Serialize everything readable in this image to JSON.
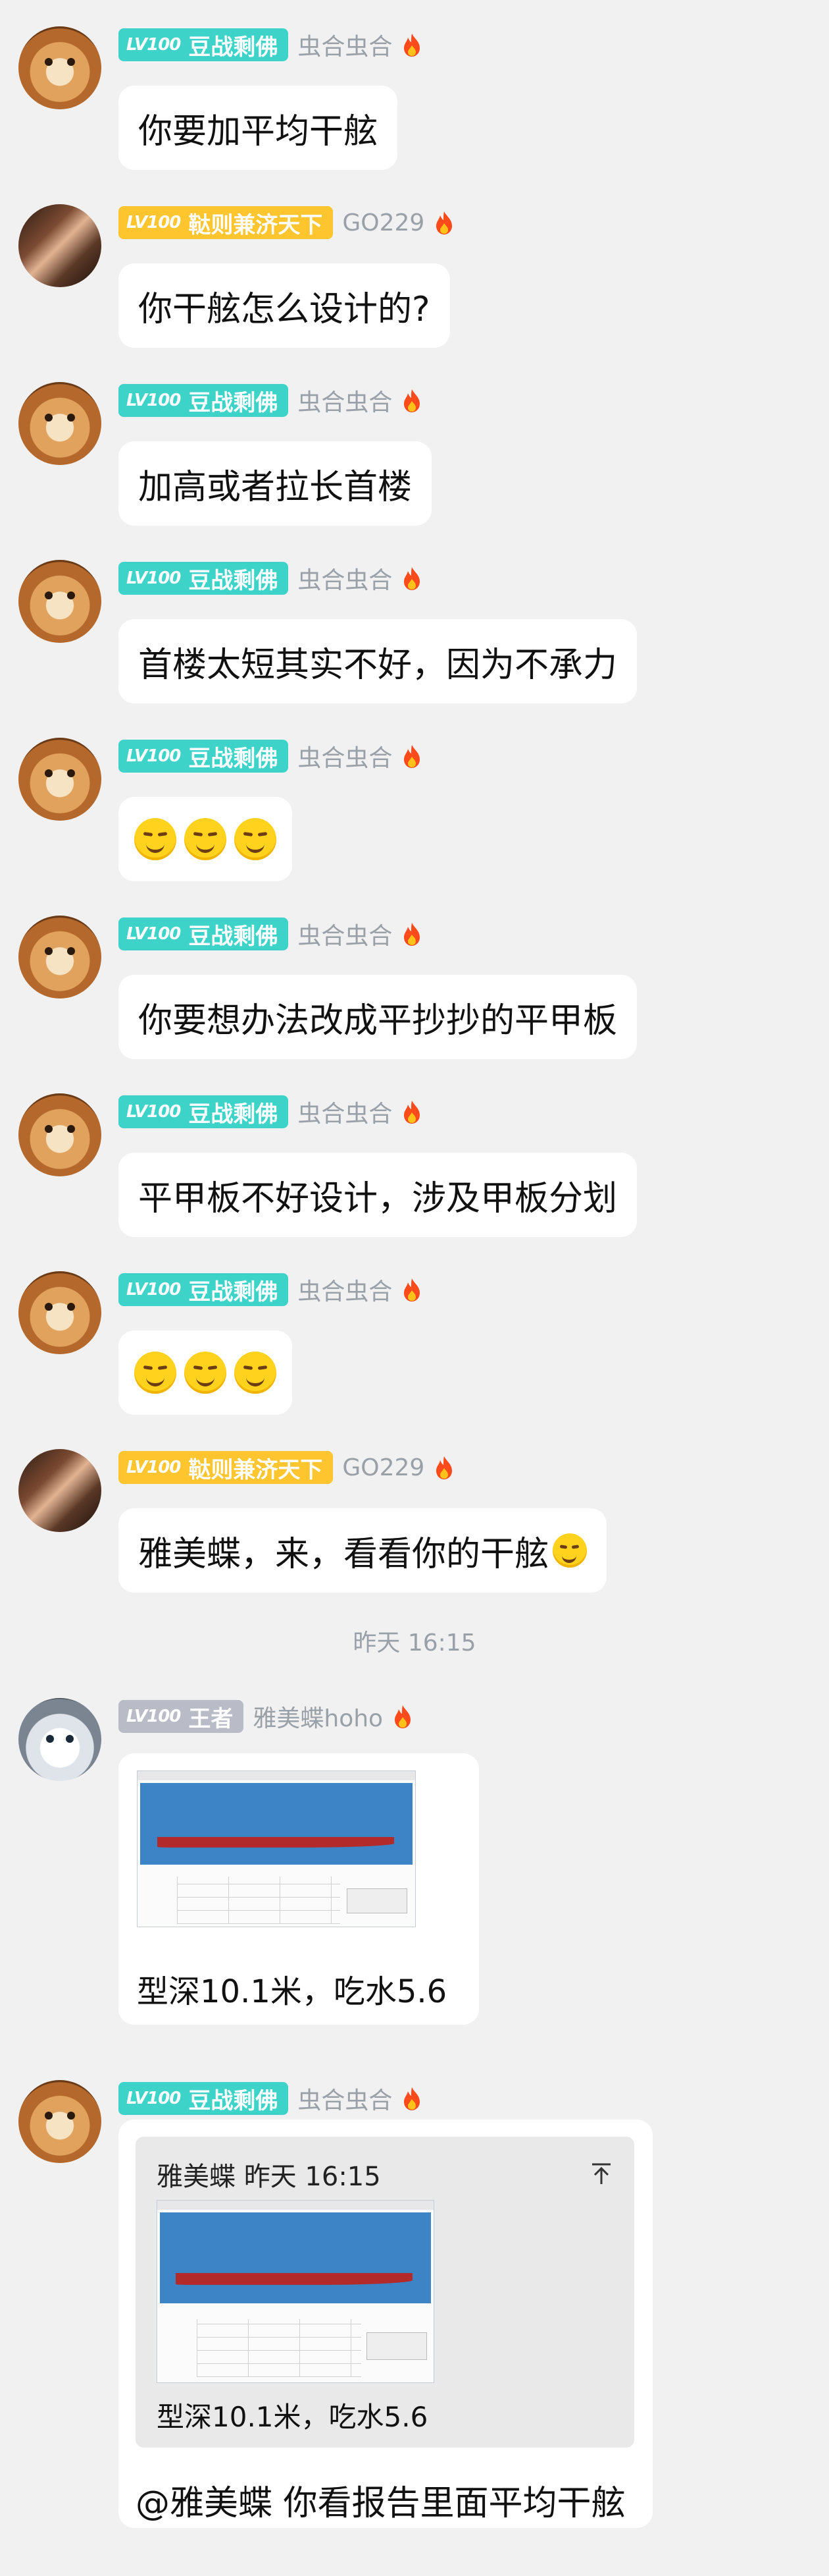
{
  "users": {
    "a": {
      "level": "LV100",
      "title": "豆战剩佛",
      "nick": "虫合虫合",
      "avatar": "shiba-dog-avatar"
    },
    "b": {
      "level": "LV100",
      "title": "鞑则兼济天下",
      "nick": "GO229",
      "avatar": "couple-photo-avatar"
    },
    "c": {
      "level": "LV100",
      "title": "王者",
      "nick": "雅美蝶hoho",
      "avatar": "husky-avatar"
    }
  },
  "messages": [
    {
      "user": "a",
      "text": "你要加平均干舷"
    },
    {
      "user": "b",
      "text": "你干舷怎么设计的?"
    },
    {
      "user": "a",
      "text": "加高或者拉长首楼"
    },
    {
      "user": "a",
      "text": "首楼太短其实不好，因为不承力"
    },
    {
      "user": "a",
      "emoji": "smirk-emoji",
      "emoji_count": 3
    },
    {
      "user": "a",
      "text": "你要想办法改成平抄抄的平甲板"
    },
    {
      "user": "a",
      "text": "平甲板不好设计，涉及甲板分划"
    },
    {
      "user": "a",
      "emoji": "smirk-emoji",
      "emoji_count": 3
    },
    {
      "user": "b",
      "text": "雅美蝶，来，看看你的干舷",
      "trailing_emoji": "smirk-emoji"
    }
  ],
  "timestamp": "昨天 16:15",
  "image_message": {
    "user": "c",
    "caption": "型深10.1米，吃水5.6"
  },
  "quote_message": {
    "user": "a",
    "quoted_header": "雅美蝶 昨天 16:15",
    "pin_icon": "pin-top-icon",
    "quoted_caption": "型深10.1米，吃水5.6",
    "reply": "@雅美蝶 你看报告里面平均干舷"
  },
  "colors": {
    "badge_teal": "#3ed3c9",
    "badge_gold": "#ffc52e",
    "badge_gray": "#b9bcc6",
    "background": "#f1f1f1"
  }
}
